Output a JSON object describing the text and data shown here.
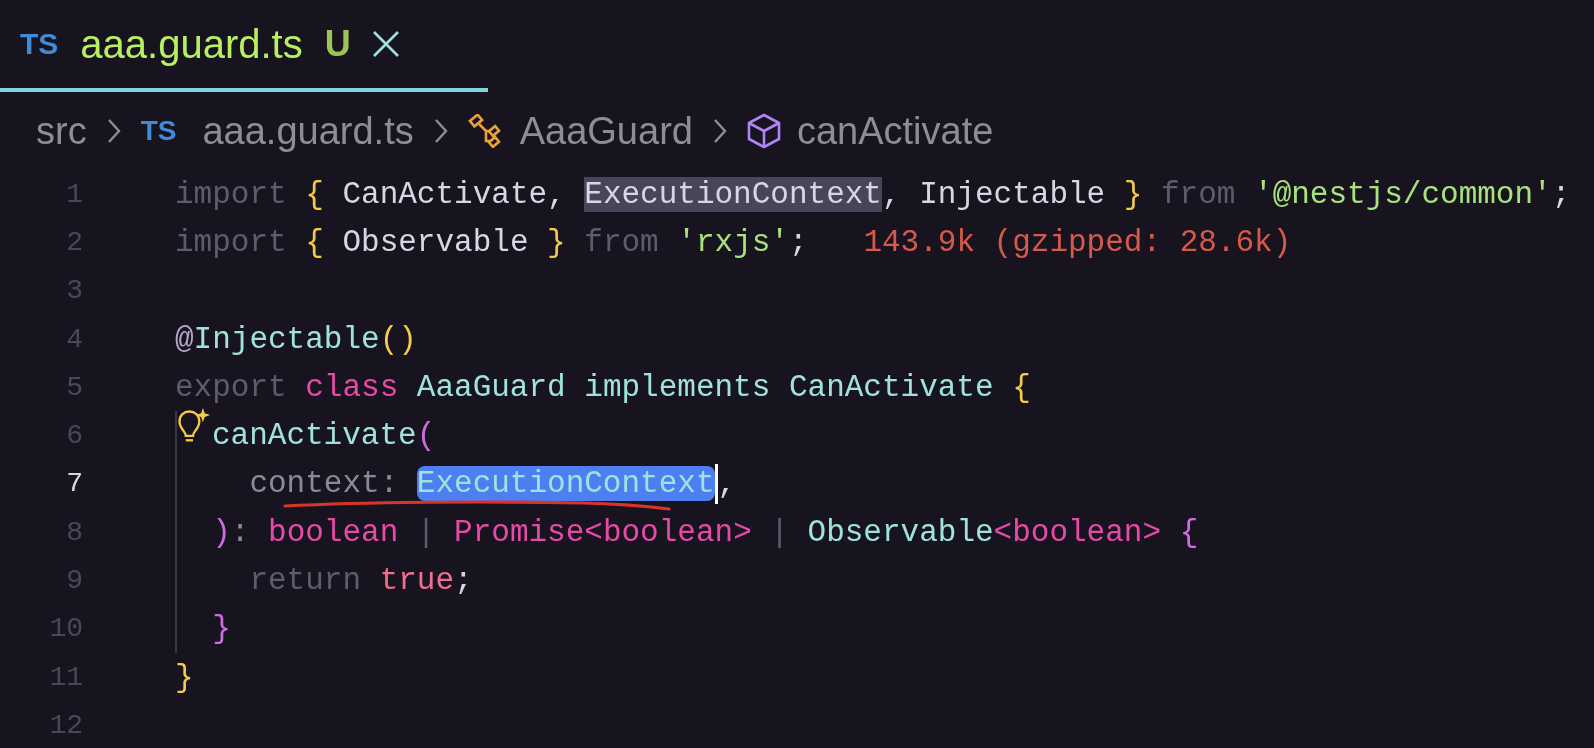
{
  "tab": {
    "badge": "TS",
    "filename": "aaa.guard.ts",
    "status": "U",
    "selected": true
  },
  "breadcrumbs": [
    {
      "label": "src",
      "kind": "folder"
    },
    {
      "label": "aaa.guard.ts",
      "kind": "file",
      "badge": "TS"
    },
    {
      "label": "AaaGuard",
      "kind": "class"
    },
    {
      "label": "canActivate",
      "kind": "method"
    }
  ],
  "lines": [
    {
      "number": "1",
      "current": false,
      "guide": false,
      "tokens": [
        {
          "text": "import ",
          "kind": "keyword"
        },
        {
          "text": "{ ",
          "kind": "brace"
        },
        {
          "text": "CanActivate, ",
          "kind": "plain"
        },
        {
          "text": "ExecutionContext",
          "kind": "plain",
          "matched": true
        },
        {
          "text": ", Injectable ",
          "kind": "plain"
        },
        {
          "text": "} ",
          "kind": "brace"
        },
        {
          "text": "from ",
          "kind": "keyword"
        },
        {
          "text": "'@nestjs/common'",
          "kind": "string"
        },
        {
          "text": ";",
          "kind": "plain"
        }
      ]
    },
    {
      "number": "2",
      "current": false,
      "guide": false,
      "tokens": [
        {
          "text": "import ",
          "kind": "keyword"
        },
        {
          "text": "{ ",
          "kind": "brace"
        },
        {
          "text": "Observable ",
          "kind": "plain"
        },
        {
          "text": "} ",
          "kind": "brace"
        },
        {
          "text": "from ",
          "kind": "keyword"
        },
        {
          "text": "'rxjs'",
          "kind": "string"
        },
        {
          "text": ";   ",
          "kind": "plain"
        },
        {
          "text": "143.9k (gzipped: 28.6k)",
          "kind": "cost"
        }
      ]
    },
    {
      "number": "3",
      "current": false,
      "guide": false
    },
    {
      "number": "4",
      "current": false,
      "guide": false,
      "tokens": [
        {
          "text": "@",
          "kind": "decorator"
        },
        {
          "text": "Injectable",
          "kind": "type"
        },
        {
          "text": "()",
          "kind": "brace"
        }
      ]
    },
    {
      "number": "5",
      "current": false,
      "guide": false,
      "tokens": [
        {
          "text": "export ",
          "kind": "keyword"
        },
        {
          "text": "class ",
          "kind": "storage"
        },
        {
          "text": "AaaGuard implements CanActivate ",
          "kind": "type"
        },
        {
          "text": "{",
          "kind": "brace"
        }
      ]
    },
    {
      "number": "6",
      "current": false,
      "guide": true,
      "lightbulb": true,
      "tokens": [
        {
          "text": "canActivate",
          "kind": "type"
        },
        {
          "text": "(",
          "kind": "bracket"
        }
      ]
    },
    {
      "number": "7",
      "current": true,
      "guide": true,
      "underlined": true,
      "tokens": [
        {
          "text": "    context: ",
          "kind": "param"
        },
        {
          "text": "ExecutionContext",
          "kind": "type",
          "selected": true,
          "cursor_after": true
        },
        {
          "text": ",",
          "kind": "plain"
        }
      ]
    },
    {
      "number": "8",
      "current": false,
      "guide": true,
      "tokens": [
        {
          "text": "  )",
          "kind": "bracket"
        },
        {
          "text": ": ",
          "kind": "param"
        },
        {
          "text": "boolean ",
          "kind": "storage"
        },
        {
          "text": "| ",
          "kind": "keyword"
        },
        {
          "text": "Promise",
          "kind": "storage"
        },
        {
          "text": "<boolean> ",
          "kind": "storage"
        },
        {
          "text": "| ",
          "kind": "keyword"
        },
        {
          "text": "Observable",
          "kind": "type"
        },
        {
          "text": "<boolean> ",
          "kind": "storage"
        },
        {
          "text": "{",
          "kind": "bracket"
        }
      ]
    },
    {
      "number": "9",
      "current": false,
      "guide": true,
      "tokens": [
        {
          "text": "    return ",
          "kind": "keyword"
        },
        {
          "text": "true",
          "kind": "literal"
        },
        {
          "text": ";",
          "kind": "plain"
        }
      ]
    },
    {
      "number": "10",
      "current": false,
      "guide": true,
      "tokens": [
        {
          "text": "  }",
          "kind": "bracket"
        }
      ]
    },
    {
      "number": "11",
      "current": false,
      "guide": false,
      "tokens": [
        {
          "text": "}",
          "kind": "brace"
        }
      ]
    },
    {
      "number": "12",
      "current": false,
      "guide": false
    }
  ]
}
